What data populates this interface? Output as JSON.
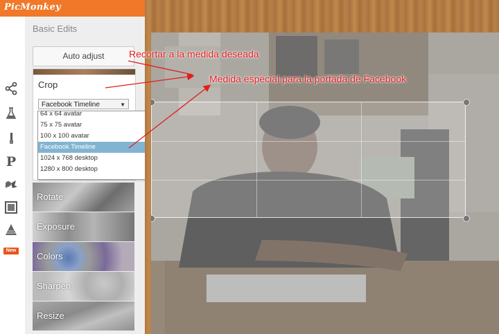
{
  "app": {
    "logo": "PicMonkey",
    "new_badge": "New"
  },
  "panel": {
    "title": "Basic Edits",
    "auto_adjust_label": "Auto adjust",
    "crop": {
      "label": "Crop",
      "selected": "Facebook Timeline",
      "options": [
        "64 x 64 avatar",
        "75 x 75 avatar",
        "100 x 100 avatar",
        "Facebook Timeline",
        "1024 x 768 desktop",
        "1280 x 800 desktop"
      ]
    },
    "tools": [
      "Rotate",
      "Exposure",
      "Colors",
      "Sharpen",
      "Resize"
    ]
  },
  "rail_icons": [
    "effects-icon",
    "touch-up-icon",
    "paintbrush-icon",
    "text-icon",
    "overlays-icon",
    "frames-icon",
    "textures-icon"
  ],
  "annotations": {
    "crop_note": "Recortar a la medida deseada",
    "facebook_note": "Medida especial para la portada de Facebook"
  },
  "colors": {
    "brand": "#f07828",
    "annotation": "#e21d1d",
    "selected_option": "#82b4d2"
  }
}
